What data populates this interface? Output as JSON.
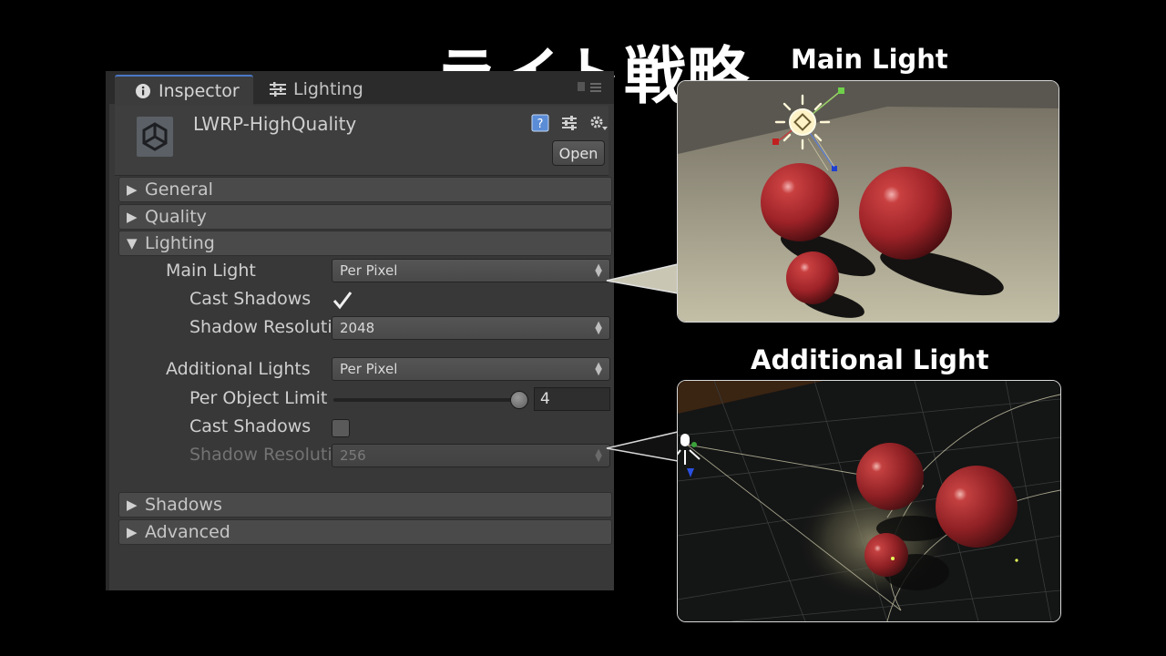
{
  "slide": {
    "title": "ライト戦略",
    "main_light_label": "Main Light",
    "additional_light_label": "Additional Light"
  },
  "inspector": {
    "tabs": [
      {
        "label": "Inspector",
        "icon": "info-icon"
      },
      {
        "label": "Lighting",
        "icon": "sliders-icon"
      }
    ],
    "asset_name": "LWRP-HighQuality",
    "open_label": "Open",
    "sections": {
      "general": "General",
      "quality": "Quality",
      "lighting": "Lighting",
      "shadows": "Shadows",
      "advanced": "Advanced"
    },
    "lighting": {
      "main_light_label": "Main Light",
      "main_light_value": "Per Pixel",
      "cast_shadows_label": "Cast Shadows",
      "main_cast_shadows": true,
      "shadow_resolution_label": "Shadow Resolutio",
      "main_shadow_resolution": "2048",
      "additional_lights_label": "Additional Lights",
      "additional_lights_value": "Per Pixel",
      "per_object_limit_label": "Per Object Limit",
      "per_object_limit_value": "4",
      "add_cast_shadows": false,
      "add_shadow_resolution": "256"
    }
  },
  "colors": {
    "background": "#000000",
    "panel": "#383838",
    "section_header": "#4a4a4a",
    "sphere_red": "#a8262b",
    "tab_accent": "#4b78c8"
  }
}
